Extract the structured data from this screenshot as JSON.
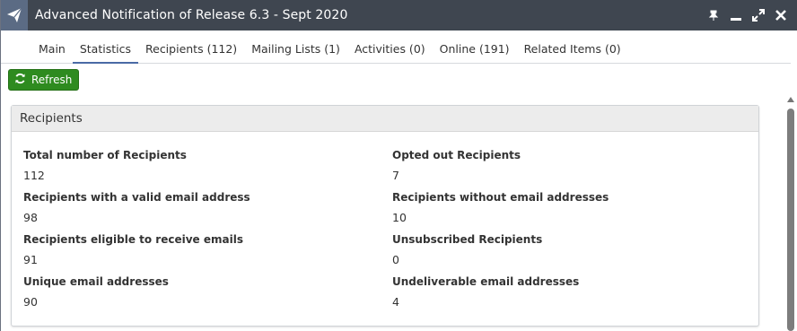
{
  "window": {
    "title": "Advanced Notification of Release 6.3 - Sept 2020",
    "app_icon": "paper-plane-icon",
    "controls": [
      "pin-icon",
      "minimize-icon",
      "maximize-icon",
      "close-icon"
    ]
  },
  "tabs": [
    {
      "label": "Main"
    },
    {
      "label": "Statistics",
      "active": true
    },
    {
      "label": "Recipients (112)"
    },
    {
      "label": "Mailing Lists (1)"
    },
    {
      "label": "Activities (0)"
    },
    {
      "label": "Online (191)"
    },
    {
      "label": "Related Items (0)"
    }
  ],
  "toolbar": {
    "refresh_label": "Refresh",
    "refresh_color": "#2e8b1f"
  },
  "panel": {
    "title": "Recipients",
    "stats": [
      {
        "label": "Total number of Recipients",
        "value": "112"
      },
      {
        "label": "Opted out Recipients",
        "value": "7"
      },
      {
        "label": "Recipients with a valid email address",
        "value": "98"
      },
      {
        "label": "Recipients without email addresses",
        "value": "10"
      },
      {
        "label": "Recipients eligible to receive emails",
        "value": "91"
      },
      {
        "label": "Unsubscribed Recipients",
        "value": "0"
      },
      {
        "label": "Unique email addresses",
        "value": "90"
      },
      {
        "label": "Undeliverable email addresses",
        "value": "4"
      }
    ]
  },
  "colors": {
    "titlebar": "#3f4650",
    "tab_active_underline": "#4a6aa5",
    "panel_header": "#ececec"
  }
}
